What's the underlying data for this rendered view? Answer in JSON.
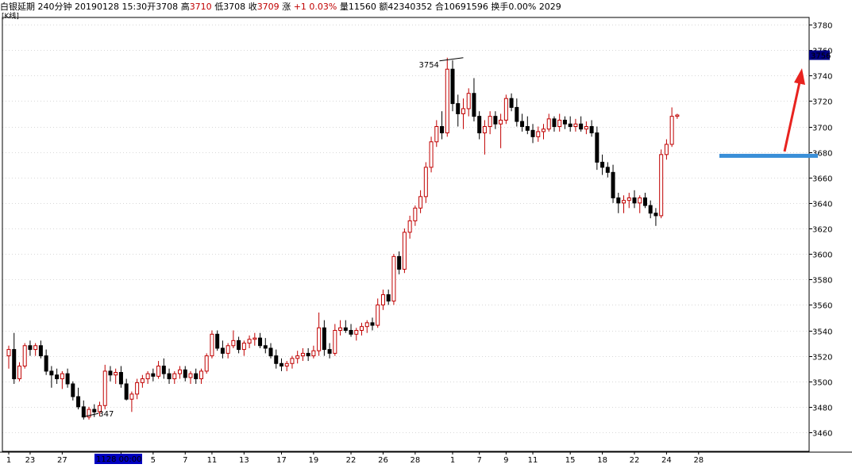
{
  "header": {
    "symbol": "白银延期",
    "period": "240分钟",
    "datetime": "20190128  15:30",
    "open_label": "开",
    "open": "3708",
    "high_label": "高",
    "high": "3710",
    "low_label": "低",
    "low": "3708",
    "close_label": "收",
    "close": "3709",
    "change_label": "涨",
    "change": "+1",
    "change_pct": "0.03%",
    "volume_label": "量",
    "volume": "11560",
    "amount_label": "额",
    "amount": "42340352",
    "oi_label": "合",
    "oi": "10691596",
    "turnover_label": "换手",
    "turnover": "0.00%",
    "extra": "2029"
  },
  "subheader": "[K线]",
  "cursor_date_label": "1128  00:00",
  "price_marker": "3756",
  "colors": {
    "up": "#c00000",
    "down": "#000000",
    "axis": "#000000",
    "grid": "#d8d8d8",
    "hline": "#3a8fd8",
    "arrow": "#e8231f",
    "price_marker_bg": "#000080",
    "cursor_bg": "#0000c0"
  },
  "chart_data": {
    "type": "candlestick",
    "ylim": [
      3440,
      3780
    ],
    "y_ticks": [
      3460,
      3480,
      3500,
      3520,
      3540,
      3560,
      3580,
      3600,
      3620,
      3640,
      3660,
      3680,
      3700,
      3720,
      3740,
      3760,
      3780
    ],
    "x_labels": [
      {
        "i": 0,
        "text": "1"
      },
      {
        "i": 4,
        "text": "23"
      },
      {
        "i": 10,
        "text": "27"
      },
      {
        "i": 21,
        "text": "2"
      },
      {
        "i": 27,
        "text": "5"
      },
      {
        "i": 33,
        "text": "7"
      },
      {
        "i": 38,
        "text": "11"
      },
      {
        "i": 44,
        "text": "13"
      },
      {
        "i": 51,
        "text": "17"
      },
      {
        "i": 57,
        "text": "19"
      },
      {
        "i": 64,
        "text": "22"
      },
      {
        "i": 70,
        "text": "26"
      },
      {
        "i": 76,
        "text": "28"
      },
      {
        "i": 83,
        "text": "1"
      },
      {
        "i": 88,
        "text": "7"
      },
      {
        "i": 93,
        "text": "9"
      },
      {
        "i": 98,
        "text": "11"
      },
      {
        "i": 105,
        "text": "15"
      },
      {
        "i": 111,
        "text": "18"
      },
      {
        "i": 117,
        "text": "22"
      },
      {
        "i": 123,
        "text": "24"
      },
      {
        "i": 129,
        "text": "28"
      }
    ],
    "annotations": [
      {
        "text": "3754",
        "value": 3754,
        "i": 85
      },
      {
        "text": "347",
        "value": 3473,
        "i": 18
      }
    ],
    "hline_value": 3677,
    "candles": [
      [
        3520,
        3528,
        3510,
        3525
      ],
      [
        3525,
        3538,
        3498,
        3502
      ],
      [
        3502,
        3515,
        3500,
        3512
      ],
      [
        3512,
        3530,
        3510,
        3528
      ],
      [
        3528,
        3532,
        3520,
        3525
      ],
      [
        3525,
        3530,
        3520,
        3528
      ],
      [
        3528,
        3532,
        3518,
        3520
      ],
      [
        3520,
        3525,
        3505,
        3508
      ],
      [
        3508,
        3512,
        3495,
        3505
      ],
      [
        3505,
        3510,
        3498,
        3502
      ],
      [
        3502,
        3508,
        3494,
        3506
      ],
      [
        3506,
        3510,
        3495,
        3498
      ],
      [
        3498,
        3500,
        3485,
        3488
      ],
      [
        3488,
        3495,
        3478,
        3480
      ],
      [
        3480,
        3485,
        3470,
        3472
      ],
      [
        3472,
        3480,
        3470,
        3478
      ],
      [
        3478,
        3482,
        3472,
        3476
      ],
      [
        3476,
        3484,
        3473,
        3481
      ],
      [
        3481,
        3513,
        3478,
        3508
      ],
      [
        3508,
        3512,
        3500,
        3505
      ],
      [
        3505,
        3510,
        3498,
        3507
      ],
      [
        3507,
        3512,
        3495,
        3498
      ],
      [
        3498,
        3502,
        3485,
        3486
      ],
      [
        3486,
        3492,
        3476,
        3490
      ],
      [
        3490,
        3502,
        3486,
        3499
      ],
      [
        3499,
        3505,
        3495,
        3502
      ],
      [
        3502,
        3508,
        3498,
        3506
      ],
      [
        3506,
        3510,
        3500,
        3504
      ],
      [
        3504,
        3516,
        3502,
        3512
      ],
      [
        3512,
        3518,
        3502,
        3506
      ],
      [
        3506,
        3510,
        3498,
        3502
      ],
      [
        3502,
        3508,
        3498,
        3506
      ],
      [
        3506,
        3512,
        3502,
        3509
      ],
      [
        3509,
        3512,
        3500,
        3503
      ],
      [
        3503,
        3508,
        3498,
        3506
      ],
      [
        3506,
        3510,
        3498,
        3502
      ],
      [
        3502,
        3510,
        3498,
        3508
      ],
      [
        3508,
        3522,
        3506,
        3520
      ],
      [
        3520,
        3540,
        3518,
        3537
      ],
      [
        3537,
        3540,
        3524,
        3526
      ],
      [
        3526,
        3532,
        3518,
        3522
      ],
      [
        3522,
        3530,
        3518,
        3528
      ],
      [
        3528,
        3540,
        3526,
        3532
      ],
      [
        3532,
        3535,
        3522,
        3525
      ],
      [
        3525,
        3532,
        3520,
        3530
      ],
      [
        3530,
        3536,
        3526,
        3533
      ],
      [
        3533,
        3538,
        3528,
        3534
      ],
      [
        3534,
        3538,
        3526,
        3528
      ],
      [
        3528,
        3534,
        3522,
        3526
      ],
      [
        3526,
        3530,
        3518,
        3520
      ],
      [
        3520,
        3525,
        3510,
        3514
      ],
      [
        3514,
        3518,
        3508,
        3512
      ],
      [
        3512,
        3516,
        3508,
        3514
      ],
      [
        3514,
        3520,
        3510,
        3518
      ],
      [
        3518,
        3524,
        3514,
        3520
      ],
      [
        3520,
        3526,
        3516,
        3522
      ],
      [
        3522,
        3526,
        3516,
        3520
      ],
      [
        3520,
        3528,
        3518,
        3524
      ],
      [
        3524,
        3554,
        3520,
        3542
      ],
      [
        3542,
        3548,
        3520,
        3525
      ],
      [
        3525,
        3530,
        3518,
        3522
      ],
      [
        3522,
        3545,
        3520,
        3540
      ],
      [
        3540,
        3548,
        3536,
        3542
      ],
      [
        3542,
        3548,
        3538,
        3540
      ],
      [
        3540,
        3545,
        3535,
        3537
      ],
      [
        3537,
        3542,
        3532,
        3540
      ],
      [
        3540,
        3546,
        3536,
        3543
      ],
      [
        3543,
        3548,
        3538,
        3546
      ],
      [
        3546,
        3550,
        3540,
        3544
      ],
      [
        3544,
        3565,
        3542,
        3560
      ],
      [
        3560,
        3572,
        3556,
        3568
      ],
      [
        3568,
        3572,
        3560,
        3563
      ],
      [
        3563,
        3600,
        3560,
        3598
      ],
      [
        3598,
        3602,
        3584,
        3588
      ],
      [
        3588,
        3620,
        3585,
        3617
      ],
      [
        3617,
        3630,
        3612,
        3626
      ],
      [
        3626,
        3638,
        3622,
        3636
      ],
      [
        3636,
        3650,
        3632,
        3645
      ],
      [
        3645,
        3672,
        3640,
        3668
      ],
      [
        3668,
        3692,
        3664,
        3688
      ],
      [
        3688,
        3705,
        3684,
        3700
      ],
      [
        3700,
        3712,
        3690,
        3695
      ],
      [
        3695,
        3754,
        3692,
        3745
      ],
      [
        3745,
        3752,
        3712,
        3718
      ],
      [
        3718,
        3725,
        3700,
        3710
      ],
      [
        3710,
        3722,
        3698,
        3714
      ],
      [
        3714,
        3730,
        3708,
        3726
      ],
      [
        3726,
        3738,
        3704,
        3708
      ],
      [
        3708,
        3712,
        3690,
        3695
      ],
      [
        3695,
        3705,
        3678,
        3700
      ],
      [
        3700,
        3712,
        3694,
        3708
      ],
      [
        3708,
        3712,
        3698,
        3702
      ],
      [
        3702,
        3710,
        3683,
        3705
      ],
      [
        3705,
        3725,
        3702,
        3722
      ],
      [
        3722,
        3726,
        3712,
        3715
      ],
      [
        3715,
        3722,
        3700,
        3704
      ],
      [
        3704,
        3710,
        3696,
        3700
      ],
      [
        3700,
        3708,
        3694,
        3697
      ],
      [
        3697,
        3702,
        3687,
        3692
      ],
      [
        3692,
        3700,
        3688,
        3696
      ],
      [
        3696,
        3702,
        3690,
        3698
      ],
      [
        3698,
        3710,
        3696,
        3706
      ],
      [
        3706,
        3708,
        3696,
        3700
      ],
      [
        3700,
        3710,
        3696,
        3705
      ],
      [
        3705,
        3708,
        3698,
        3702
      ],
      [
        3702,
        3708,
        3696,
        3700
      ],
      [
        3700,
        3706,
        3696,
        3702
      ],
      [
        3702,
        3708,
        3696,
        3698
      ],
      [
        3698,
        3704,
        3694,
        3700
      ],
      [
        3700,
        3705,
        3692,
        3695
      ],
      [
        3695,
        3700,
        3666,
        3672
      ],
      [
        3672,
        3678,
        3662,
        3668
      ],
      [
        3668,
        3672,
        3660,
        3664
      ],
      [
        3664,
        3670,
        3640,
        3644
      ],
      [
        3644,
        3648,
        3632,
        3640
      ],
      [
        3640,
        3646,
        3632,
        3642
      ],
      [
        3642,
        3648,
        3636,
        3644
      ],
      [
        3644,
        3650,
        3636,
        3640
      ],
      [
        3640,
        3646,
        3632,
        3644
      ],
      [
        3644,
        3648,
        3636,
        3638
      ],
      [
        3638,
        3642,
        3628,
        3632
      ],
      [
        3632,
        3636,
        3622,
        3630
      ],
      [
        3630,
        3682,
        3628,
        3678
      ],
      [
        3678,
        3690,
        3674,
        3686
      ],
      [
        3686,
        3715,
        3684,
        3708
      ],
      [
        3708,
        3710,
        3706,
        3709
      ]
    ]
  }
}
